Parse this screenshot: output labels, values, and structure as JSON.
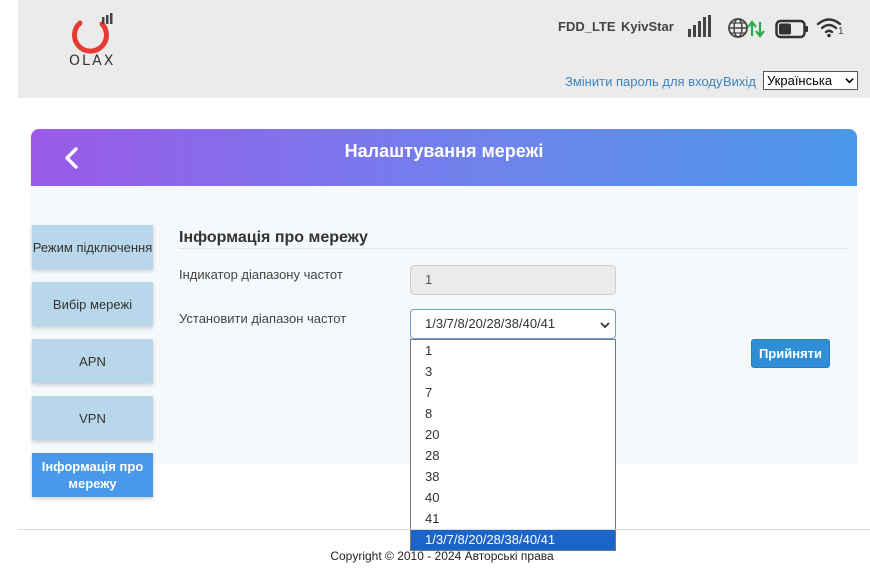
{
  "header": {
    "logo_text": "OLAX",
    "network_type": "FDD_LTE",
    "carrier": "KyivStar",
    "wifi_clients": "1",
    "change_password_link": "Змінити пароль для входу",
    "logout_link": "Вихід",
    "language": "Українська",
    "icons": [
      "signal-bars-icon",
      "globe-icon",
      "data-arrows-icon",
      "battery-icon",
      "wifi-icon"
    ],
    "colors": {
      "logo_red": "#e63a35",
      "arrows_green": "#2aa84a",
      "link_blue": "#3b86c6"
    }
  },
  "panel": {
    "title": "Налаштування мережі",
    "gradient": [
      "#9a5ae8",
      "#4b98ea"
    ]
  },
  "side_menu": {
    "items": [
      {
        "label": "Режим підключення",
        "active": false
      },
      {
        "label": "Вибір мережі",
        "active": false
      },
      {
        "label": "APN",
        "active": false
      },
      {
        "label": "VPN",
        "active": false
      },
      {
        "label": "Інформація про мережу",
        "active": true
      }
    ]
  },
  "content": {
    "section_title": "Інформація про мережу",
    "band_indicator_label": "Індикатор діапазону частот",
    "band_indicator_value": "1",
    "set_band_label": "Установити діапазон частот",
    "set_band_value": "1/3/7/8/20/28/38/40/41",
    "accept_button": "Прийняти"
  },
  "dropdown": {
    "options": [
      "1",
      "3",
      "7",
      "8",
      "20",
      "28",
      "38",
      "40",
      "41",
      "1/3/7/8/20/28/38/40/41"
    ],
    "selected": "1/3/7/8/20/28/38/40/41"
  },
  "footer": {
    "copyright": "Copyright © 2010 - 2024 Авторські права"
  }
}
